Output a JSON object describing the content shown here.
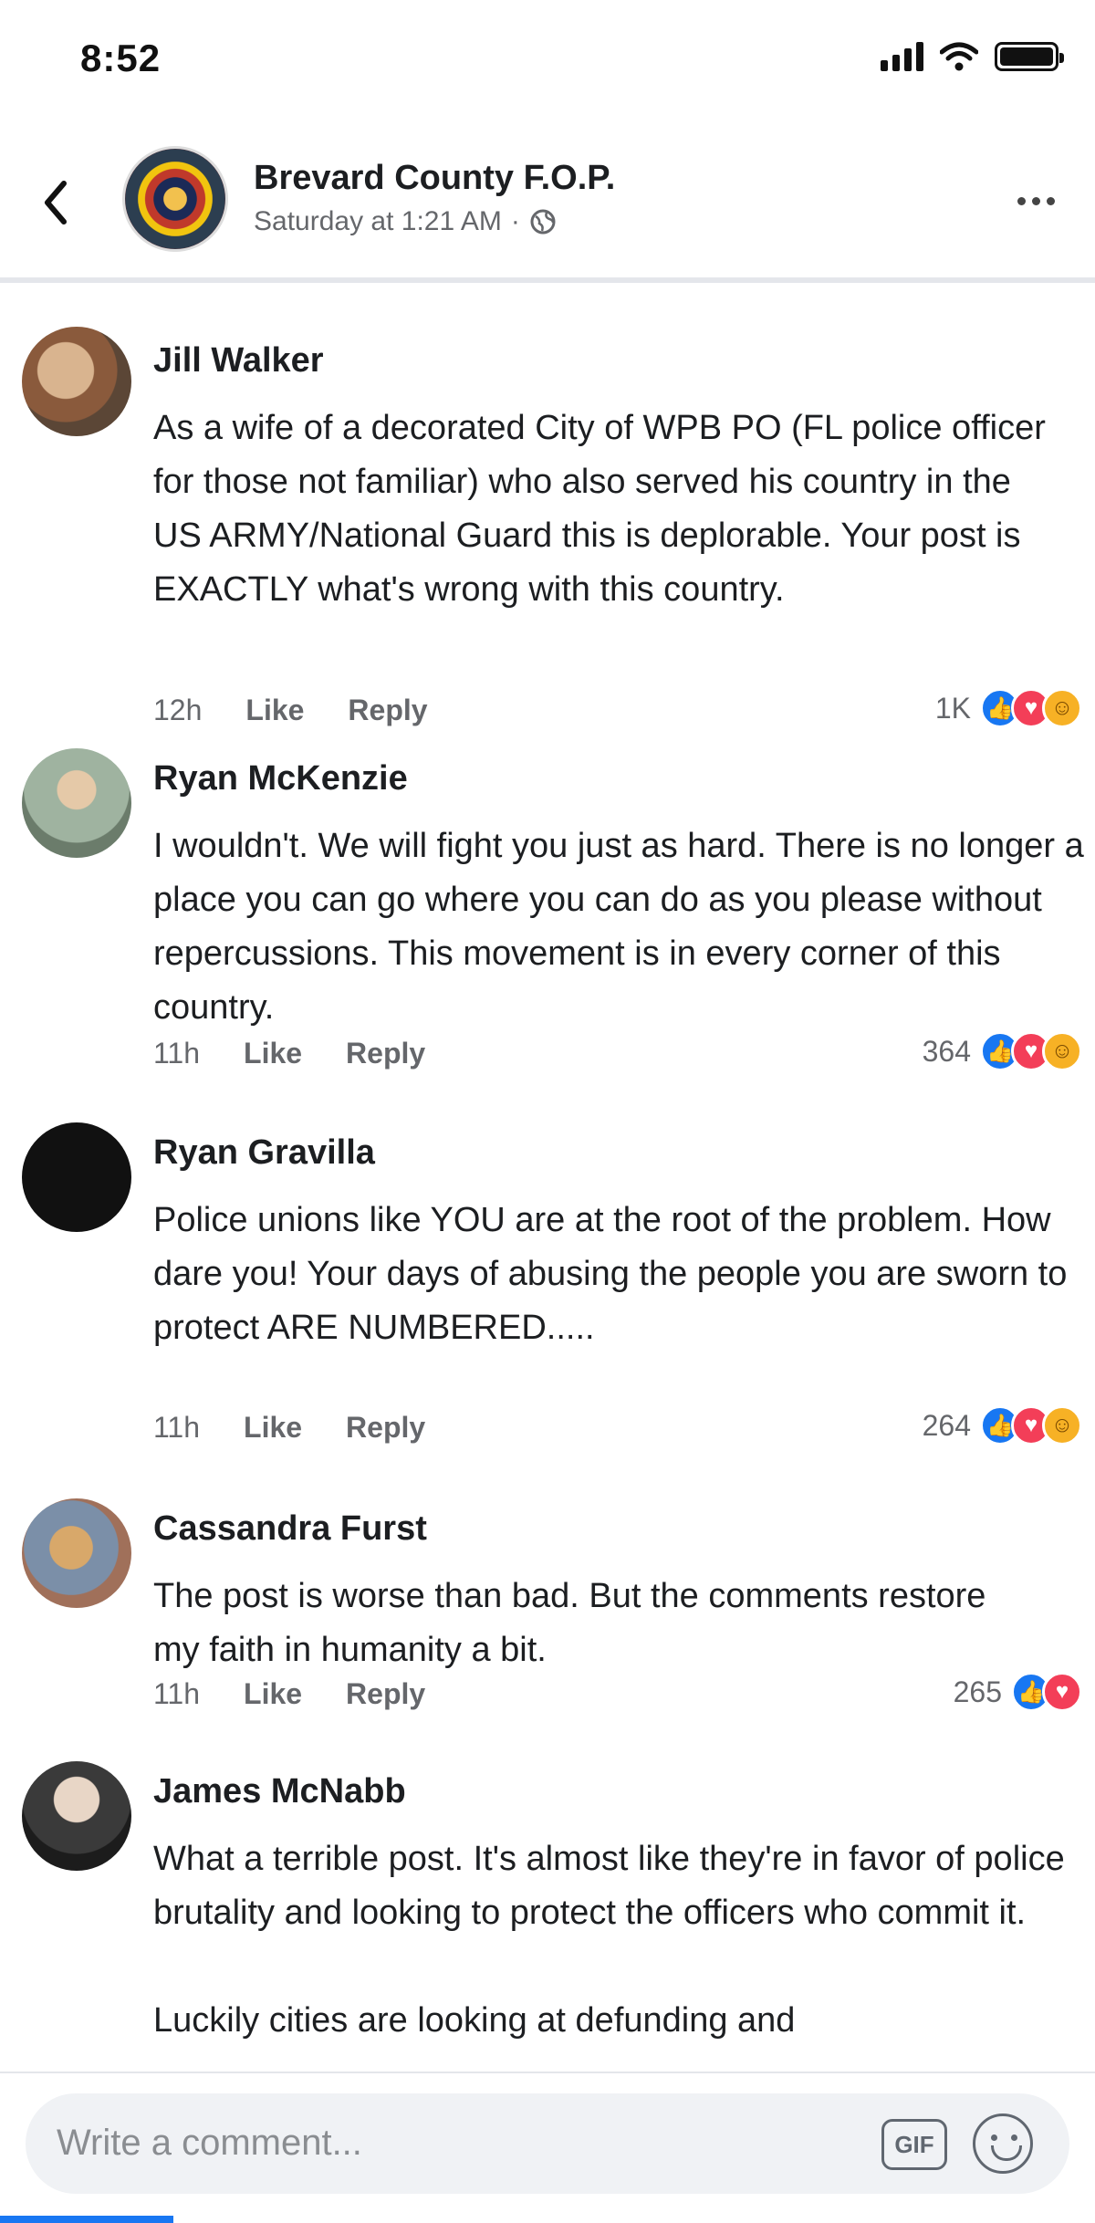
{
  "status_bar": {
    "time": "8:52"
  },
  "post_header": {
    "page_name": "Brevard County F.O.P.",
    "timestamp": "Saturday at 1:21 AM",
    "separator": "·"
  },
  "comments": [
    {
      "author": "Jill Walker",
      "text": "As a wife of a decorated City of WPB PO (FL police officer for those not familiar) who also served his country in the US ARMY/National Guard this is deplorable. Your post is EXACTLY what's wrong with this country.",
      "time": "12h",
      "like_label": "Like",
      "reply_label": "Reply",
      "reaction_count": "1K",
      "reactions": [
        "like",
        "love",
        "care"
      ]
    },
    {
      "author": "Ryan McKenzie",
      "text": "I wouldn't.  We will fight you just as hard.  There is no longer a place you can go where you can do as you please without repercussions.  This movement is in every corner of this country.",
      "time": "11h",
      "like_label": "Like",
      "reply_label": "Reply",
      "reaction_count": "364",
      "reactions": [
        "like",
        "love",
        "care"
      ]
    },
    {
      "author": "Ryan Gravilla",
      "text": "Police unions like YOU are at the root of the problem. How dare you! Your days of abusing the people you are sworn to protect ARE NUMBERED.....",
      "time": "11h",
      "like_label": "Like",
      "reply_label": "Reply",
      "reaction_count": "264",
      "reactions": [
        "like",
        "love",
        "care"
      ]
    },
    {
      "author": "Cassandra Furst",
      "text": "The post is worse than bad. But the comments restore my faith in humanity a bit.",
      "time": "11h",
      "like_label": "Like",
      "reply_label": "Reply",
      "reaction_count": "265",
      "reactions": [
        "like",
        "love"
      ]
    },
    {
      "author": "James McNabb",
      "text": "What a terrible post. It's almost like they're in favor of police brutality and looking to protect the officers who commit it.\n\nLuckily cities are looking at defunding and"
    }
  ],
  "composer": {
    "placeholder": "Write a comment...",
    "gif_label": "GIF"
  },
  "colors": {
    "like": "#1877f2",
    "love": "#f33e58",
    "care": "#f7b125",
    "secondary_text": "#65676b"
  },
  "icons": {
    "back": "chevron-left-icon",
    "more": "more-horizontal-icon",
    "globe": "globe-icon",
    "emoji": "smiley-icon"
  }
}
